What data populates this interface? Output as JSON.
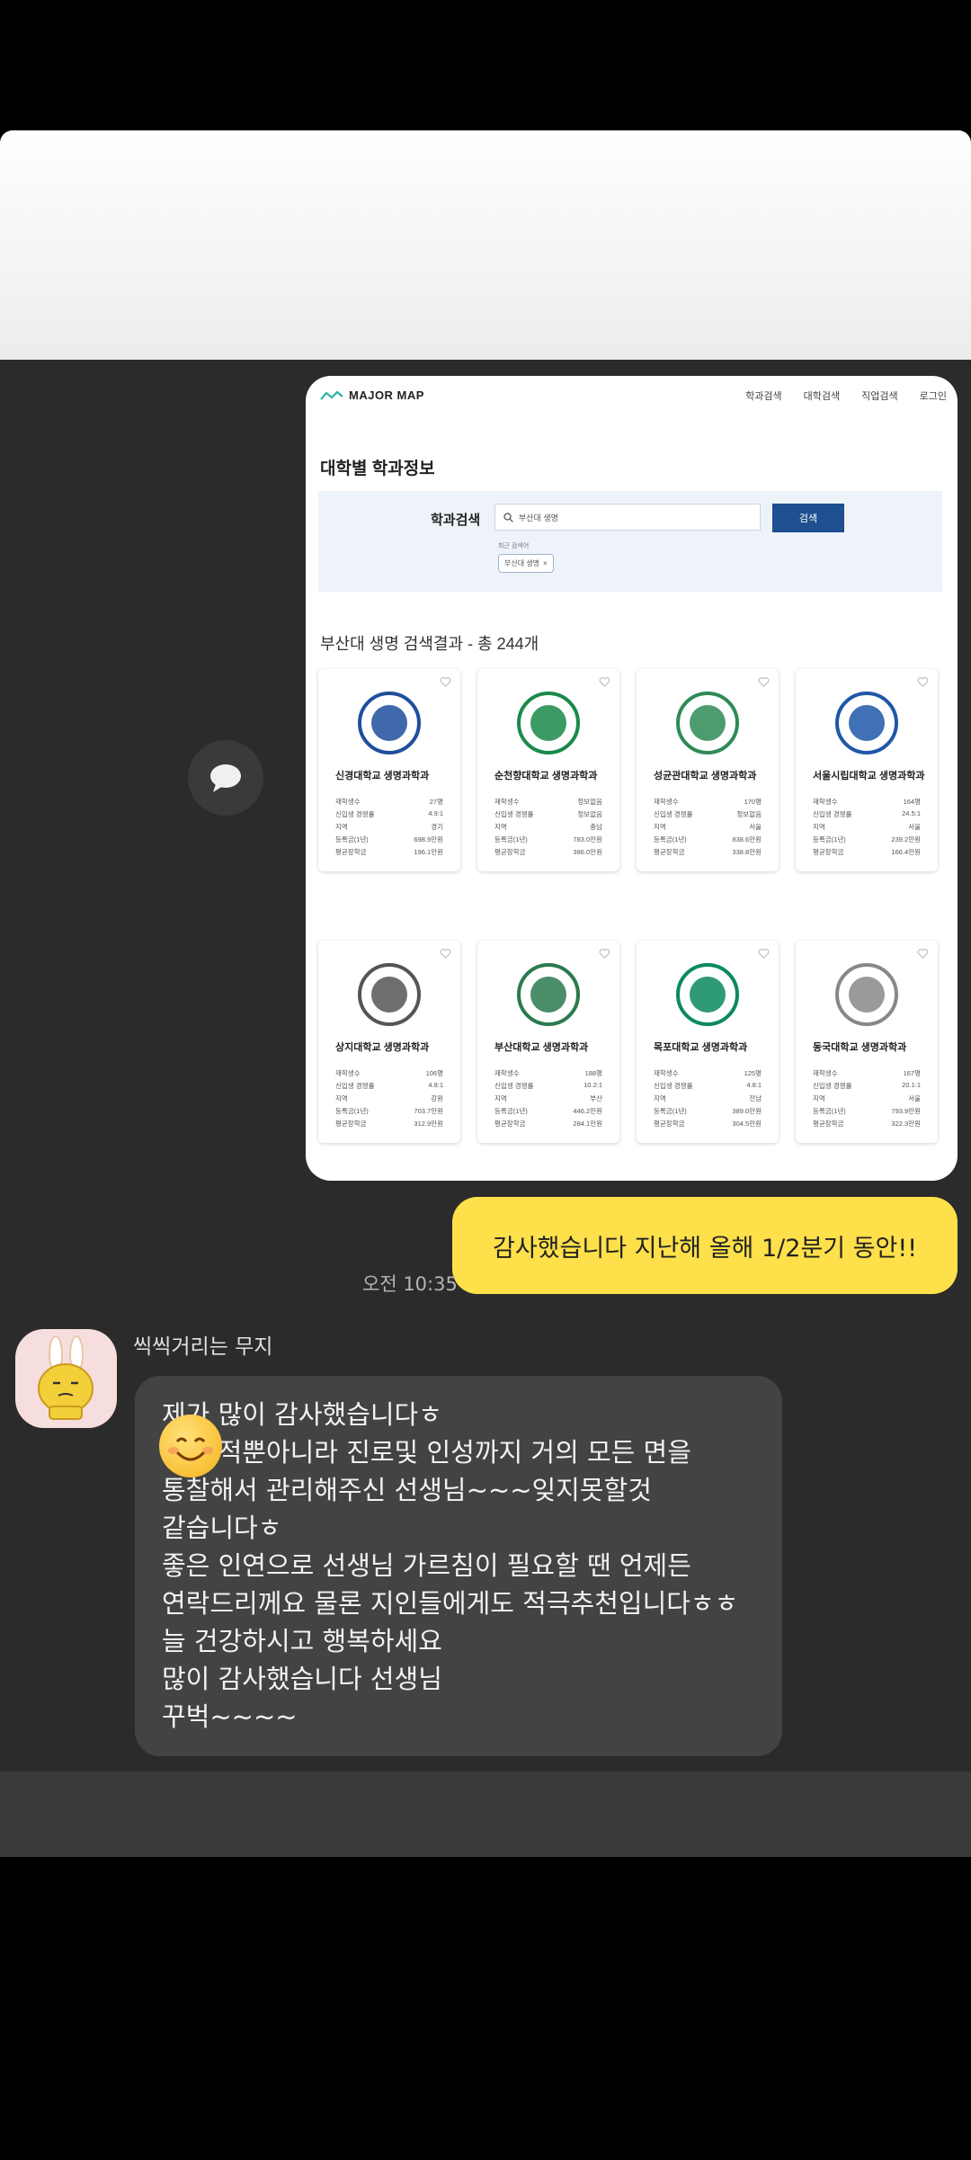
{
  "site": {
    "logo": "MAJOR MAP",
    "nav": [
      "학과검색",
      "대학검색",
      "직업검색",
      "로그인"
    ],
    "page_title": "대학별 학과정보",
    "search_label": "학과검색",
    "search_value": "부산대 생명",
    "search_button": "검색",
    "recent_label": "최근 검색어",
    "recent_chip": "부산대 생명",
    "result_title": "부산대 생명 검색결과 - 총 244개",
    "cards": [
      {
        "name": "신경대학교  생명과학과",
        "stats": [
          [
            "재학생수",
            "27명"
          ],
          [
            "신입생 경쟁률",
            "4.9:1"
          ],
          [
            "지역",
            "경기"
          ],
          [
            "등록금(1년)",
            "698.9만원"
          ],
          [
            "평균장학금",
            "196.1만원"
          ]
        ]
      },
      {
        "name": "순천향대학교  생명과학과",
        "stats": [
          [
            "재학생수",
            "정보없음"
          ],
          [
            "신입생 경쟁률",
            "정보없음"
          ],
          [
            "지역",
            "충남"
          ],
          [
            "등록금(1년)",
            "783.0만원"
          ],
          [
            "평균장학금",
            "386.0만원"
          ]
        ]
      },
      {
        "name": "성균관대학교  생명과학과",
        "stats": [
          [
            "재학생수",
            "170명"
          ],
          [
            "신입생 경쟁률",
            "정보없음"
          ],
          [
            "지역",
            "서울"
          ],
          [
            "등록금(1년)",
            "838.6만원"
          ],
          [
            "평균장학금",
            "338.8만원"
          ]
        ]
      },
      {
        "name": "서울시립대학교  생명과학과",
        "stats": [
          [
            "재학생수",
            "164명"
          ],
          [
            "신입생 경쟁률",
            "24.5:1"
          ],
          [
            "지역",
            "서울"
          ],
          [
            "등록금(1년)",
            "239.2만원"
          ],
          [
            "평균장학금",
            "166.4만원"
          ]
        ]
      },
      {
        "name": "상지대학교  생명과학과",
        "stats": [
          [
            "재학생수",
            "106명"
          ],
          [
            "신입생 경쟁률",
            "4.8:1"
          ],
          [
            "지역",
            "강원"
          ],
          [
            "등록금(1년)",
            "703.7만원"
          ],
          [
            "평균장학금",
            "312.9만원"
          ]
        ]
      },
      {
        "name": "부산대학교  생명과학과",
        "stats": [
          [
            "재학생수",
            "188명"
          ],
          [
            "신입생 경쟁률",
            "10.2:1"
          ],
          [
            "지역",
            "부산"
          ],
          [
            "등록금(1년)",
            "446.2만원"
          ],
          [
            "평균장학금",
            "284.1만원"
          ]
        ]
      },
      {
        "name": "목포대학교  생명과학과",
        "stats": [
          [
            "재학생수",
            "125명"
          ],
          [
            "신입생 경쟁률",
            "4.8:1"
          ],
          [
            "지역",
            "전남"
          ],
          [
            "등록금(1년)",
            "389.0만원"
          ],
          [
            "평균장학금",
            "304.5만원"
          ]
        ]
      },
      {
        "name": "동국대학교  생명과학과",
        "stats": [
          [
            "재학생수",
            "167명"
          ],
          [
            "신입생 경쟁률",
            "20.1:1"
          ],
          [
            "지역",
            "서울"
          ],
          [
            "등록금(1년)",
            "793.9만원"
          ],
          [
            "평균장학금",
            "322.3만원"
          ]
        ]
      }
    ]
  },
  "chat": {
    "outgoing_text": "감사했습니다 지난해 올해 1/2분기 동안!!",
    "outgoing_time": "오전 10:35",
    "sender_name": "씩씩거리는 무지",
    "incoming_lines": [
      "제가 많이 감사했습니다ㅎ",
      "      이 성적뿐아니라 진로및 인성까지 거의 모든 면을",
      "통찰해서 관리해주신 선생님~~~잊지못할것",
      "같습니다ㅎ",
      "좋은 인연으로 선생님 가르침이 필요할 땐 언제든",
      "연락드리께요 물론 지인들에게도 적극추천입니다ㅎㅎ",
      "늘 건강하시고 행복하세요",
      "많이 감사했습니다 선생님",
      "꾸벅~~~~"
    ]
  },
  "colors": {
    "bubble_out": "#fde04a",
    "bubble_in": "#434343",
    "chat_bg": "#2b2b2b",
    "search_button": "#1e4f8f"
  }
}
